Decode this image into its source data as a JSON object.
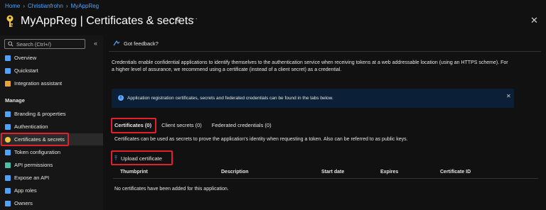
{
  "breadcrumb": [
    "Home",
    "Christianfrohn",
    "MyAppReg"
  ],
  "title": "MyAppReg | Certificates & secrets",
  "search": {
    "placeholder": "Search (Ctrl+/)"
  },
  "sidebar": {
    "items_top": [
      {
        "label": "Overview",
        "icon": "overview-icon",
        "color": "#4da3ff"
      },
      {
        "label": "Quickstart",
        "icon": "quickstart-icon",
        "color": "#4da3ff"
      },
      {
        "label": "Integration assistant",
        "icon": "rocket-icon",
        "color": "#e8a23a"
      }
    ],
    "section": "Manage",
    "items_manage": [
      {
        "label": "Branding & properties",
        "icon": "branding-icon",
        "color": "#4da3ff"
      },
      {
        "label": "Authentication",
        "icon": "authentication-icon",
        "color": "#4da3ff"
      },
      {
        "label": "Certificates & secrets",
        "icon": "key-icon",
        "color": "#f2c744"
      },
      {
        "label": "Token configuration",
        "icon": "token-icon",
        "color": "#4da3ff"
      },
      {
        "label": "API permissions",
        "icon": "api-permissions-icon",
        "color": "#48c0a8"
      },
      {
        "label": "Expose an API",
        "icon": "cloud-icon",
        "color": "#4da3ff"
      },
      {
        "label": "App roles",
        "icon": "app-roles-icon",
        "color": "#4da3ff"
      },
      {
        "label": "Owners",
        "icon": "owners-icon",
        "color": "#4da3ff"
      }
    ]
  },
  "feedback": "Got feedback?",
  "description": "Credentials enable confidential applications to identify themselves to the authentication service when receiving tokens at a web addressable location (using an HTTPS scheme). For a higher level of assurance, we recommend using a certificate (instead of a client secret) as a credential.",
  "info_bar": "Application registration certificates, secrets and federated credentials can be found in the tabs below.",
  "tabs": [
    "Certificates (0)",
    "Client secrets (0)",
    "Federated credentials (0)"
  ],
  "tab_description": "Certificates can be used as secrets to prove the application's identity when requesting a token. Also can be referred to as public keys.",
  "upload_label": "Upload certificate",
  "table": {
    "columns": [
      "Thumbprint",
      "Description",
      "Start date",
      "Expires",
      "Certificate ID"
    ],
    "empty_text": "No certificates have been added for this application."
  },
  "colors": {
    "accent": "#4da3ff",
    "highlight": "#e0202a",
    "background": "#111111"
  }
}
